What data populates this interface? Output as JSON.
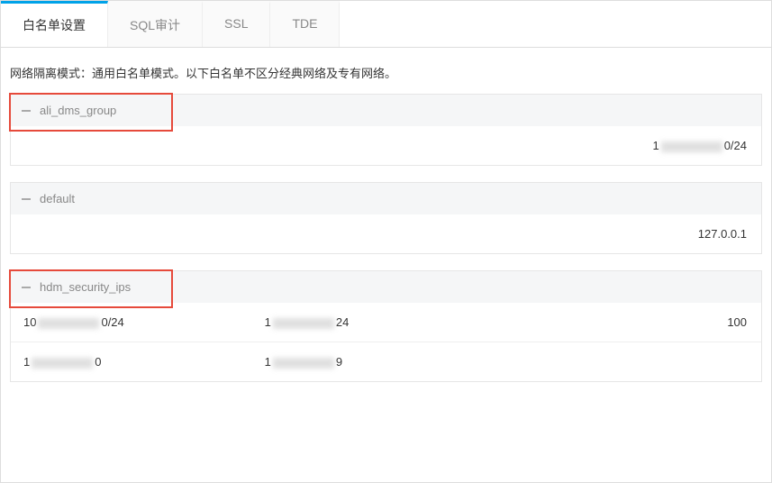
{
  "tabs": [
    {
      "id": "whitelist",
      "label": "白名单设置",
      "active": true
    },
    {
      "id": "sql-audit",
      "label": "SQL审计",
      "active": false
    },
    {
      "id": "ssl",
      "label": "SSL",
      "active": false
    },
    {
      "id": "tde",
      "label": "TDE",
      "active": false
    }
  ],
  "desc": "网络隔离模式：通用白名单模式。以下白名单不区分经典网络及专有网络。",
  "groups": [
    {
      "name": "ali_dms_group",
      "highlighted": true,
      "rows": [
        [
          {
            "prefix": "1",
            "suffix": "0/24",
            "blur": true
          }
        ]
      ]
    },
    {
      "name": "default",
      "highlighted": false,
      "rows": [
        [
          {
            "text": "127.0.0.1"
          }
        ]
      ]
    },
    {
      "name": "hdm_security_ips",
      "highlighted": true,
      "rows": [
        [
          {
            "prefix": "10",
            "suffix": "0/24",
            "blur": true
          },
          {
            "prefix": "1",
            "suffix": "24",
            "blur": true
          },
          {
            "text": "100"
          }
        ],
        [
          {
            "prefix": "1",
            "suffix": "0",
            "blur": true
          },
          {
            "prefix": "1",
            "suffix": "9",
            "blur": true
          },
          {
            "text": ""
          }
        ]
      ]
    }
  ]
}
